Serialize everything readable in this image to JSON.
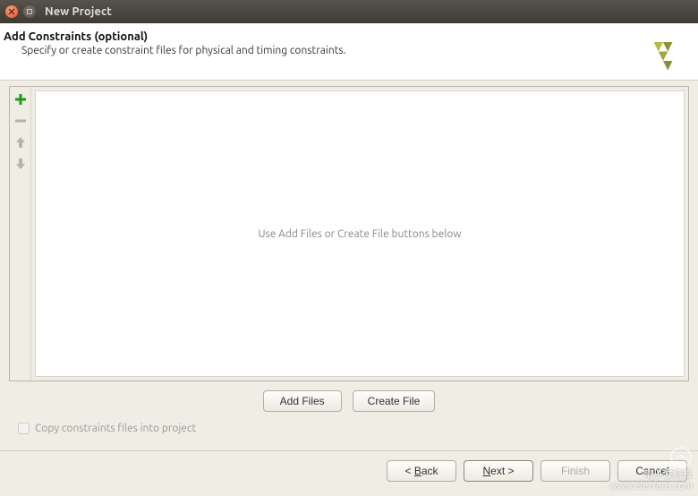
{
  "window": {
    "title": "New Project"
  },
  "header": {
    "title": "Add Constraints (optional)",
    "subtitle": "Specify or create constraint files for physical and timing constraints."
  },
  "file_area": {
    "placeholder": "Use Add Files or Create File buttons below"
  },
  "buttons": {
    "add_files": "Add Files",
    "create_file": "Create File"
  },
  "checkbox": {
    "copy_constraints": "Copy constraints files into project"
  },
  "footer": {
    "back": "< Back",
    "next": "Next >",
    "finish": "Finish",
    "cancel": "Cancel"
  },
  "watermark": {
    "line1": "电子发烧友",
    "line2": "www.elecfans.com"
  }
}
